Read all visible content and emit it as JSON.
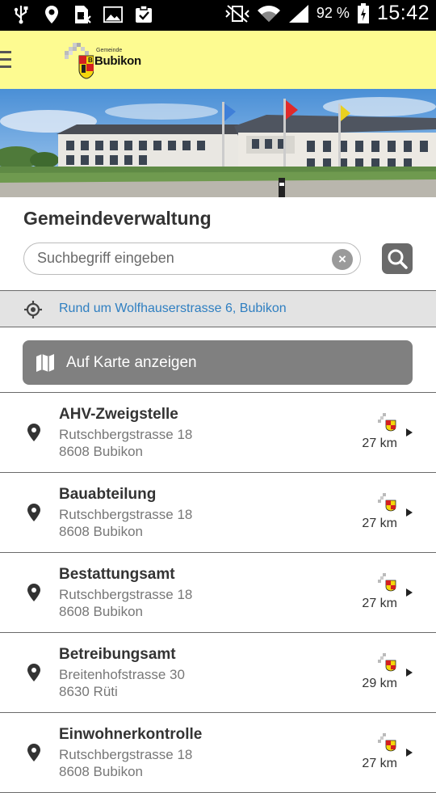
{
  "status_bar": {
    "battery": "92 %",
    "time": "15:42"
  },
  "header": {
    "logo_small": "Gemeinde",
    "logo_name": "Bubikon"
  },
  "page": {
    "title": "Gemeindeverwaltung"
  },
  "search": {
    "placeholder": "Suchbegriff eingeben",
    "value": ""
  },
  "location": {
    "text": "Rund um Wolfhauserstrasse 6, Bubikon"
  },
  "map_button": {
    "label": "Auf Karte anzeigen"
  },
  "items": [
    {
      "name": "AHV-Zweigstelle",
      "street": "Rutschbergstrasse 18",
      "city": "8608 Bubikon",
      "distance": "27 km"
    },
    {
      "name": "Bauabteilung",
      "street": "Rutschbergstrasse 18",
      "city": "8608 Bubikon",
      "distance": "27 km"
    },
    {
      "name": "Bestattungsamt",
      "street": "Rutschbergstrasse 18",
      "city": "8608 Bubikon",
      "distance": "27 km"
    },
    {
      "name": "Betreibungsamt",
      "street": "Breitenhofstrasse 30",
      "city": "8630 Rüti",
      "distance": "29 km"
    },
    {
      "name": "Einwohnerkontrolle",
      "street": "Rutschbergstrasse 18",
      "city": "8608 Bubikon",
      "distance": "27 km"
    }
  ],
  "icons": {
    "status_left": [
      "usb-icon",
      "location-icon",
      "sim-icon",
      "gallery-icon",
      "clipboard-icon"
    ],
    "status_right": [
      "vibrate-icon",
      "wifi-icon",
      "signal-icon",
      "battery-icon"
    ]
  },
  "colors": {
    "header_bg": "#fdfb91",
    "link": "#2f7fc1",
    "button_gray": "#808080"
  }
}
